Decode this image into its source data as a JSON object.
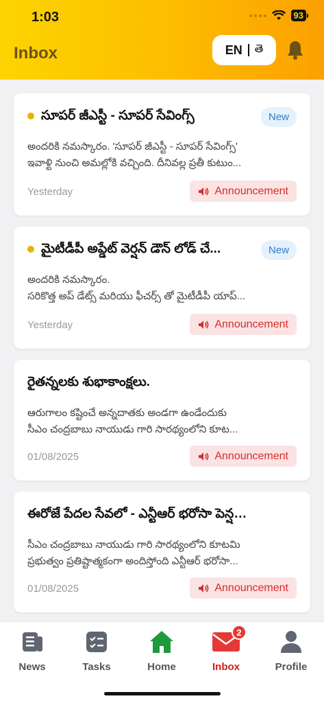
{
  "status": {
    "time": "1:03",
    "battery": "93"
  },
  "header": {
    "title": "Inbox",
    "lang_en": "EN",
    "lang_te": "తె"
  },
  "colors": {
    "accent": "#fdbb00",
    "announcement": "#d62c2c",
    "active_nav": "#d01c1c",
    "unread_dot": "#e8b400"
  },
  "messages": [
    {
      "title": "సూపర్ జీఎస్టీ - సూపర్ సేవింగ్స్",
      "unread": true,
      "badge": "New",
      "body_line1": "అందరికి నమస్కారం. 'సూపర్ జీఎస్టీ - సూపర్ సేవింగ్స్'",
      "body_line2": "ఇవాళ్టి నుంచి అమల్లోకి వచ్చింది. దీనివల్ల ప్రతీ కుటుం...",
      "date": "Yesterday",
      "tag": "Announcement"
    },
    {
      "title": "మైటీడీపీ అప్డేట్ వెర్షన్ డౌన్ లోడ్ చే...",
      "unread": true,
      "badge": "New",
      "body_line1": "అందరికి నమస్కారం.",
      "body_line2": "సరికొత్త అప్ డేట్స్ మరియు ఫీచర్స్ తో మైటీడీపీ యాప్...",
      "date": "Yesterday",
      "tag": "Announcement"
    },
    {
      "title": "రైతన్నలకు శుభాకాంక్షలు.",
      "unread": false,
      "badge": "",
      "body_line1": "ఆరుగాలం కష్టించే అన్నదాతకు అండగా ఉండేందుకు",
      "body_line2": "సీఎం చంద్రబాబు నాయుడు గారి సారథ్యంలోని కూట...",
      "date": "01/08/2025",
      "tag": "Announcement"
    },
    {
      "title": "ఈరోజే పేదల సేవలో - ఎన్టీఆర్ భరోసా పెన్షన్లు...",
      "unread": false,
      "badge": "",
      "body_line1": "సీఎం చంద్రబాబు నాయుడు గారి సారథ్యంలోని కూటమి",
      "body_line2": "ప్రభుత్వం ప్రతిష్టాత్మకంగా అందిస్తోంది ఎన్టీఆర్ భరోసా...",
      "date": "01/08/2025",
      "tag": "Announcement"
    }
  ],
  "nav": {
    "news": "News",
    "tasks": "Tasks",
    "home": "Home",
    "inbox": "Inbox",
    "profile": "Profile",
    "inbox_badge": "2"
  }
}
